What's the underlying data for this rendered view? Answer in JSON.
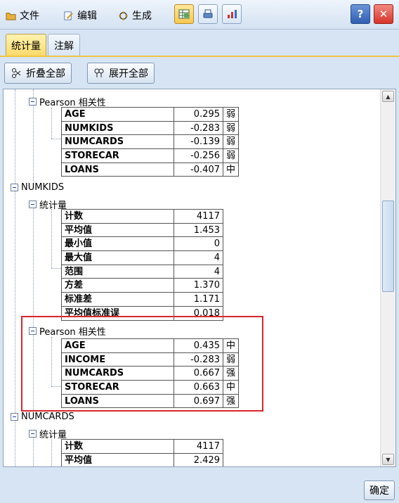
{
  "menu": {
    "file": "文件",
    "edit": "编辑",
    "generate": "生成"
  },
  "toolbar": {
    "icons": [
      "output-table-icon",
      "print-icon",
      "chart-sort-icon"
    ]
  },
  "window": {
    "help": "?",
    "close": "✕"
  },
  "tabs": [
    "统计量",
    "注解"
  ],
  "actions": {
    "collapse_all": "折叠全部",
    "expand_all": "展开全部"
  },
  "tree": {
    "pearson1": {
      "label": "Pearson 相关性",
      "rows": [
        {
          "name": "AGE",
          "value": "0.295",
          "strength": "弱"
        },
        {
          "name": "NUMKIDS",
          "value": "-0.283",
          "strength": "弱"
        },
        {
          "name": "NUMCARDS",
          "value": "-0.139",
          "strength": "弱"
        },
        {
          "name": "STORECAR",
          "value": "-0.256",
          "strength": "弱"
        },
        {
          "name": "LOANS",
          "value": "-0.407",
          "strength": "中"
        }
      ]
    },
    "numkids": {
      "label": "NUMKIDS",
      "stats_label": "统计量",
      "stats": [
        {
          "name": "计数",
          "value": "4117"
        },
        {
          "name": "平均值",
          "value": "1.453"
        },
        {
          "name": "最小值",
          "value": "0"
        },
        {
          "name": "最大值",
          "value": "4"
        },
        {
          "name": "范围",
          "value": "4"
        },
        {
          "name": "方差",
          "value": "1.370"
        },
        {
          "name": "标准差",
          "value": "1.171"
        },
        {
          "name": "平均值标准误",
          "value": "0.018"
        }
      ],
      "pearson_label": "Pearson 相关性",
      "pearson": [
        {
          "name": "AGE",
          "value": "0.435",
          "strength": "中"
        },
        {
          "name": "INCOME",
          "value": "-0.283",
          "strength": "弱"
        },
        {
          "name": "NUMCARDS",
          "value": "0.667",
          "strength": "强"
        },
        {
          "name": "STORECAR",
          "value": "0.663",
          "strength": "中"
        },
        {
          "name": "LOANS",
          "value": "0.697",
          "strength": "强"
        }
      ]
    },
    "numcards": {
      "label": "NUMCARDS",
      "stats_label": "统计量",
      "stats": [
        {
          "name": "计数",
          "value": "4117"
        },
        {
          "name": "平均值",
          "value": "2.429"
        }
      ]
    }
  },
  "ok_label": "确定",
  "colors": {
    "highlight": "#d9262c",
    "active_tab": "#f8da6a",
    "background": "#d6e4f3"
  }
}
